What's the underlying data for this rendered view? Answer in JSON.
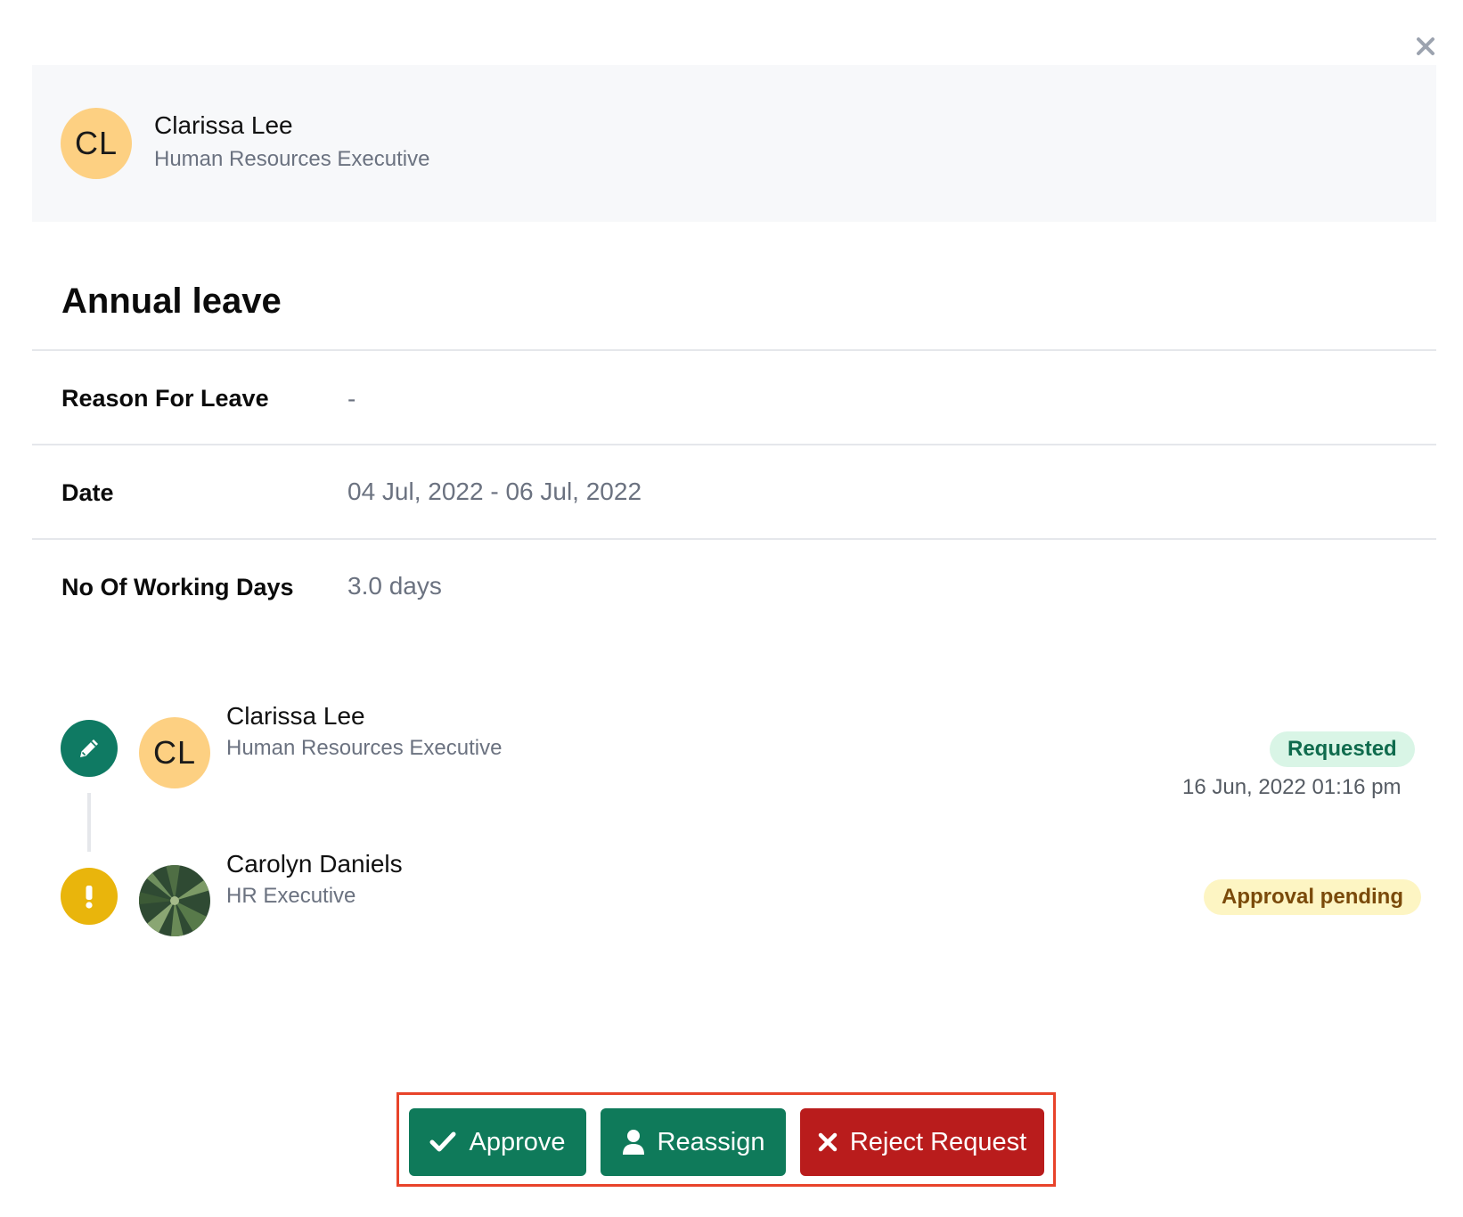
{
  "modal": {
    "close_label": "×"
  },
  "requester": {
    "initials": "CL",
    "name": "Clarissa Lee",
    "role": "Human Resources Executive"
  },
  "leave": {
    "title": "Annual leave",
    "details": [
      {
        "label": "Reason For Leave",
        "value": "-"
      },
      {
        "label": "Date",
        "value": "04 Jul, 2022 - 06 Jul, 2022"
      },
      {
        "label": "No Of Working Days",
        "value": "3.0 days"
      }
    ]
  },
  "timeline": [
    {
      "status_icon": "pencil-icon",
      "initials": "CL",
      "name": "Clarissa Lee",
      "role": "Human Resources Executive",
      "badge": "Requested",
      "badge_color": "#d9f5e6",
      "timestamp": "16 Jun, 2022 01:16 pm"
    },
    {
      "status_icon": "exclamation-icon",
      "avatar": "photo-avatar",
      "name": "Carolyn Daniels",
      "role": "HR Executive",
      "badge": "Approval pending",
      "badge_color": "#fdf5c3"
    }
  ],
  "actions": {
    "approve_label": "Approve",
    "reassign_label": "Reassign",
    "reject_label": "Reject Request",
    "approve_icon": "check-icon",
    "reassign_icon": "user-icon",
    "reject_icon": "x-icon",
    "primary_color": "#0f7a5a",
    "danger_color": "#b91c1c"
  }
}
